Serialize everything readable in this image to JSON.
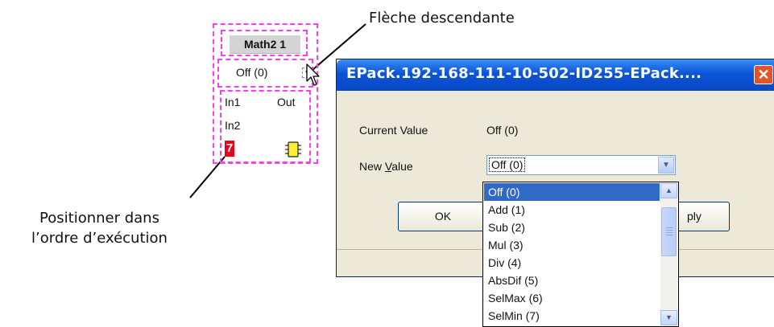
{
  "annotations": {
    "down_arrow": "Flèche descendante",
    "execution_order_line1": "Positionner dans",
    "execution_order_line2": "l’ordre d’exécution"
  },
  "block": {
    "title": "Math2 1",
    "value": "Off (0)",
    "arrow_glyph": "▼",
    "input_1": "In1",
    "input_2": "In2",
    "output": "Out",
    "execution_order": "7",
    "chip_icon": "chip-icon"
  },
  "dialog": {
    "title": "EPack.192-168-111-10-502-ID255-EPack....",
    "close_glyph": "✕",
    "current_value_label": "Current Value",
    "current_value": "Off (0)",
    "new_value_label_pre": "New ",
    "new_value_label_accel": "V",
    "new_value_label_post": "alue",
    "new_value_selected": "Off (0)",
    "ok_label": "OK",
    "apply_label_visible": "ply"
  },
  "dropdown": {
    "options": [
      "Off (0)",
      "Add (1)",
      "Sub (2)",
      "Mul (3)",
      "Div (4)",
      "AbsDif (5)",
      "SelMax (6)",
      "SelMin (7)"
    ],
    "selected_index": 0
  },
  "colors": {
    "dashed_outline": "#ff3df0",
    "order_badge": "#e8001c",
    "selection": "#316ac5",
    "title_bar": "#0a54d6",
    "close_button": "#e4542b"
  }
}
